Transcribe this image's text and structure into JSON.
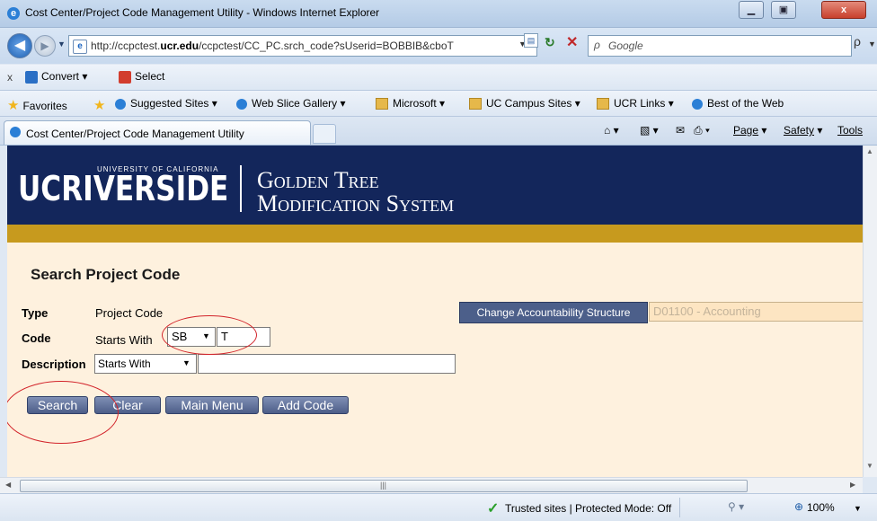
{
  "window": {
    "title": "Cost Center/Project Code Management Utility - Windows Internet Explorer",
    "minimize": "▁",
    "restore": "▣",
    "close": "x"
  },
  "address": {
    "url_pre": "http://ccpctest.",
    "url_domain": "ucr.edu",
    "url_post": "/ccpctest/CC_PC.srch_code?sUserid=BOBBIB&cboT",
    "search_placeholder": "Google"
  },
  "toolbar": {
    "close_x": "x",
    "convert_label": "Convert",
    "select_label": "Select"
  },
  "favorites": {
    "favorites_label": "Favorites",
    "items": [
      "Suggested Sites",
      "Web Slice Gallery",
      "Microsoft",
      "UC Campus Sites",
      "UCR Links",
      "Best of the Web"
    ]
  },
  "tab": {
    "label": "Cost Center/Project Code Management Utility",
    "page_menu": "Page",
    "safety_menu": "Safety",
    "tools_menu": "Tools"
  },
  "banner": {
    "logo_main": "UCRIVERSIDE",
    "logo_sub": "UNIVERSITY OF CALIFORNIA",
    "title_line1": "Golden Tree",
    "title_line2": "Modification System"
  },
  "form": {
    "heading": "Search Project Code",
    "type_label": "Type",
    "type_value": "Project Code",
    "code_label": "Code",
    "code_mode": "Starts With",
    "code_prefix": "SB",
    "code_value": "T",
    "desc_label": "Description",
    "desc_mode": "Starts With",
    "desc_value": "",
    "accountability_button": "Change Accountability Structure",
    "accountability_value": "D01100 - Accounting"
  },
  "buttons": {
    "search": "Search",
    "clear": "Clear",
    "main_menu": "Main Menu",
    "add_code": "Add Code"
  },
  "status": {
    "zone_text": "Trusted sites | Protected Mode: Off",
    "zoom": "100%"
  },
  "colors": {
    "banner_navy": "#13265b",
    "gold_bar": "#c79a1e",
    "page_bg": "#fef1de",
    "annotation_red": "#d2232a"
  }
}
